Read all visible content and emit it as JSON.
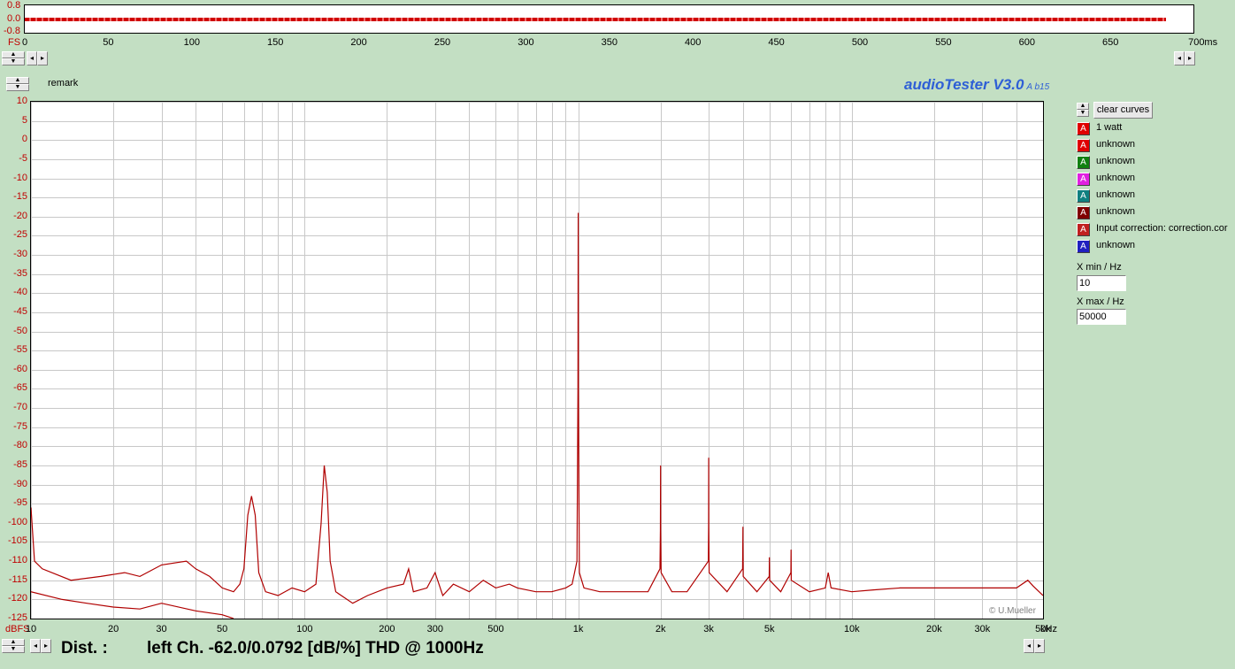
{
  "top_scope": {
    "y_labels": [
      "0.8",
      "0.0",
      "-0.8"
    ],
    "fs_label": "FS",
    "x_labels": [
      "0",
      "50",
      "100",
      "150",
      "200",
      "250",
      "300",
      "350",
      "400",
      "450",
      "500",
      "550",
      "600",
      "650",
      "700ms"
    ]
  },
  "app": {
    "remark_label": "remark",
    "title": "audioTester V3.0",
    "version_suffix": "A b15"
  },
  "legend": {
    "clear_button": "clear curves",
    "swatch_letter": "A",
    "items": [
      {
        "label": "1 watt",
        "color": "#e00000"
      },
      {
        "label": "unknown",
        "color": "#e00000"
      },
      {
        "label": "unknown",
        "color": "#108010"
      },
      {
        "label": "unknown",
        "color": "#e020e0"
      },
      {
        "label": "unknown",
        "color": "#108080"
      },
      {
        "label": "unknown",
        "color": "#800000"
      },
      {
        "label": "Input correction: correction.cor",
        "color": "#c02020"
      },
      {
        "label": "unknown",
        "color": "#2020c0"
      }
    ],
    "xmin_label": "X min / Hz",
    "xmin_value": "10",
    "xmax_label": "X max / Hz",
    "xmax_value": "50000"
  },
  "copyright": "© U.Mueller",
  "status": {
    "dist_label": "Dist. :",
    "result": "left Ch. -62.0/0.0792 [dB/%] THD @ 1000Hz"
  },
  "chart_data": {
    "type": "line",
    "x_scale": "log",
    "xlim": [
      10,
      50000
    ],
    "ylim": [
      -125,
      10
    ],
    "y_unit_label": "dBFS",
    "x_unit_label": "kHz",
    "y_ticks": [
      "10",
      "5",
      "0",
      "-5",
      "-10",
      "-15",
      "-20",
      "-25",
      "-30",
      "-35",
      "-40",
      "-45",
      "-50",
      "-55",
      "-60",
      "-65",
      "-70",
      "-75",
      "-80",
      "-85",
      "-90",
      "-95",
      "-100",
      "-105",
      "-110",
      "-115",
      "-120",
      "-125"
    ],
    "x_ticks": [
      {
        "v": 10,
        "label": "10"
      },
      {
        "v": 20,
        "label": "20"
      },
      {
        "v": 30,
        "label": "30"
      },
      {
        "v": 50,
        "label": "50"
      },
      {
        "v": 100,
        "label": "100"
      },
      {
        "v": 200,
        "label": "200"
      },
      {
        "v": 300,
        "label": "300"
      },
      {
        "v": 500,
        "label": "500"
      },
      {
        "v": 1000,
        "label": "1k"
      },
      {
        "v": 2000,
        "label": "2k"
      },
      {
        "v": 3000,
        "label": "3k"
      },
      {
        "v": 5000,
        "label": "5k"
      },
      {
        "v": 10000,
        "label": "10k"
      },
      {
        "v": 20000,
        "label": "20k"
      },
      {
        "v": 30000,
        "label": "30k"
      },
      {
        "v": 50000,
        "label": "50k"
      }
    ],
    "grid": true,
    "series": [
      {
        "color": "#b00000",
        "points": [
          [
            10,
            -96
          ],
          [
            10.3,
            -110
          ],
          [
            11,
            -112
          ],
          [
            14,
            -115
          ],
          [
            18,
            -114
          ],
          [
            22,
            -113
          ],
          [
            25,
            -114
          ],
          [
            30,
            -111
          ],
          [
            37,
            -110
          ],
          [
            40,
            -112
          ],
          [
            45,
            -114
          ],
          [
            50,
            -117
          ],
          [
            55,
            -118
          ],
          [
            58,
            -116
          ],
          [
            60,
            -112
          ],
          [
            62,
            -98
          ],
          [
            64,
            -93
          ],
          [
            66,
            -98
          ],
          [
            68,
            -113
          ],
          [
            72,
            -118
          ],
          [
            80,
            -119
          ],
          [
            90,
            -117
          ],
          [
            100,
            -118
          ],
          [
            110,
            -116
          ],
          [
            115,
            -100
          ],
          [
            118,
            -85
          ],
          [
            121,
            -92
          ],
          [
            124,
            -110
          ],
          [
            130,
            -118
          ],
          [
            150,
            -121
          ],
          [
            170,
            -119
          ],
          [
            200,
            -117
          ],
          [
            230,
            -116
          ],
          [
            240,
            -112
          ],
          [
            250,
            -118
          ],
          [
            280,
            -117
          ],
          [
            300,
            -113
          ],
          [
            320,
            -119
          ],
          [
            350,
            -116
          ],
          [
            400,
            -118
          ],
          [
            450,
            -115
          ],
          [
            500,
            -117
          ],
          [
            560,
            -116
          ],
          [
            600,
            -117
          ],
          [
            700,
            -118
          ],
          [
            800,
            -118
          ],
          [
            900,
            -117
          ],
          [
            950,
            -116
          ],
          [
            990,
            -110
          ],
          [
            998,
            -65
          ],
          [
            1000,
            -19
          ],
          [
            1002,
            -65
          ],
          [
            1010,
            -113
          ],
          [
            1050,
            -117
          ],
          [
            1200,
            -118
          ],
          [
            1500,
            -118
          ],
          [
            1800,
            -118
          ],
          [
            1990,
            -112
          ],
          [
            1998,
            -102
          ],
          [
            2000,
            -85
          ],
          [
            2002,
            -102
          ],
          [
            2010,
            -113
          ],
          [
            2200,
            -118
          ],
          [
            2500,
            -118
          ],
          [
            2990,
            -110
          ],
          [
            2998,
            -101
          ],
          [
            3000,
            -83
          ],
          [
            3002,
            -101
          ],
          [
            3010,
            -113
          ],
          [
            3500,
            -118
          ],
          [
            3990,
            -112
          ],
          [
            3998,
            -104
          ],
          [
            4000,
            -101
          ],
          [
            4002,
            -104
          ],
          [
            4010,
            -114
          ],
          [
            4500,
            -118
          ],
          [
            4990,
            -114
          ],
          [
            5000,
            -109
          ],
          [
            5010,
            -115
          ],
          [
            5500,
            -118
          ],
          [
            5990,
            -113
          ],
          [
            6000,
            -107
          ],
          [
            6010,
            -115
          ],
          [
            7000,
            -118
          ],
          [
            8000,
            -117
          ],
          [
            8200,
            -113
          ],
          [
            8400,
            -117
          ],
          [
            10000,
            -118
          ],
          [
            12000,
            -117.5
          ],
          [
            15000,
            -117
          ],
          [
            20000,
            -117
          ],
          [
            25000,
            -117
          ],
          [
            30000,
            -117
          ],
          [
            40000,
            -117
          ],
          [
            44000,
            -115
          ],
          [
            46000,
            -116.5
          ],
          [
            50000,
            -119
          ]
        ]
      },
      {
        "color": "#b00000",
        "points": [
          [
            10,
            -118
          ],
          [
            13,
            -120
          ],
          [
            16,
            -121
          ],
          [
            20,
            -122
          ],
          [
            25,
            -122.5
          ],
          [
            30,
            -121
          ],
          [
            40,
            -123
          ],
          [
            50,
            -124
          ],
          [
            55,
            -125
          ]
        ]
      }
    ]
  }
}
